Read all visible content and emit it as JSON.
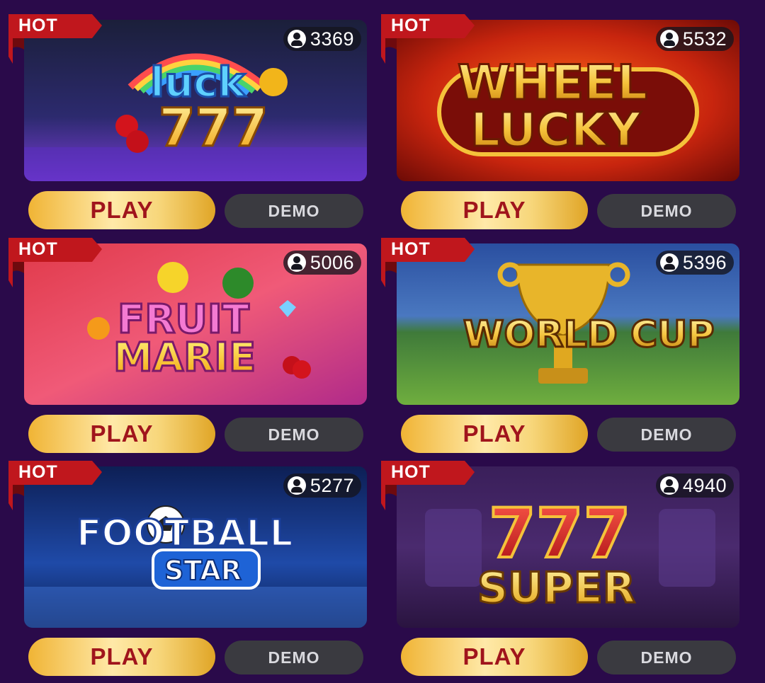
{
  "games": [
    {
      "badge": "HOT",
      "players": "3369",
      "art_title": "luck",
      "art_sub": "777",
      "play_label": "PLAY",
      "demo_label": "DEMO"
    },
    {
      "badge": "HOT",
      "players": "5532",
      "art_title": "WHEEL",
      "art_sub": "LUCKY",
      "play_label": "PLAY",
      "demo_label": "DEMO"
    },
    {
      "badge": "HOT",
      "players": "5006",
      "art_title": "FRUIT",
      "art_sub": "MARIE",
      "play_label": "PLAY",
      "demo_label": "DEMO"
    },
    {
      "badge": "HOT",
      "players": "5396",
      "art_title": "WORLD CUP",
      "art_sub": "",
      "play_label": "PLAY",
      "demo_label": "DEMO"
    },
    {
      "badge": "HOT",
      "players": "5277",
      "art_title": "FOOTBALL",
      "art_sub": "STAR",
      "play_label": "PLAY",
      "demo_label": "DEMO"
    },
    {
      "badge": "HOT",
      "players": "4940",
      "art_title": "777",
      "art_sub": "SUPER",
      "play_label": "PLAY",
      "demo_label": "DEMO"
    }
  ],
  "colors": {
    "page_background": "#2a0a4a",
    "play_text": "#a0151c",
    "play_gold": "#f7d67a",
    "demo_background": "#3a3a40",
    "hot_ribbon": "#c0171d"
  }
}
